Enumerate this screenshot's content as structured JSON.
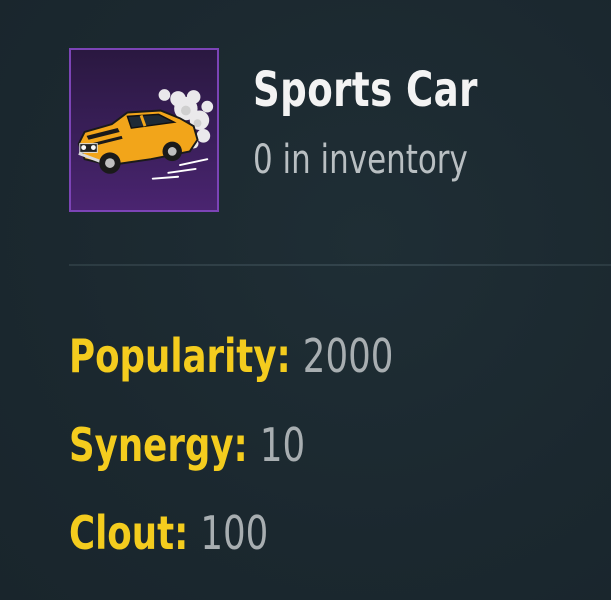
{
  "item": {
    "name": "Sports Car",
    "inventory_text": "0 in inventory",
    "icon": "sports-car-icon"
  },
  "stats": [
    {
      "label": "Popularity:",
      "value": "2000"
    },
    {
      "label": "Synergy:",
      "value": "10"
    },
    {
      "label": "Clout:",
      "value": "100"
    }
  ],
  "colors": {
    "background": "#1c2a31",
    "title": "#f3f3f3",
    "subtitle": "#b9bfc2",
    "stat_label": "#f4cc1e",
    "stat_value": "#a8aeb1",
    "thumb_border": "#7c44b6",
    "car_body": "#f2a51a"
  }
}
